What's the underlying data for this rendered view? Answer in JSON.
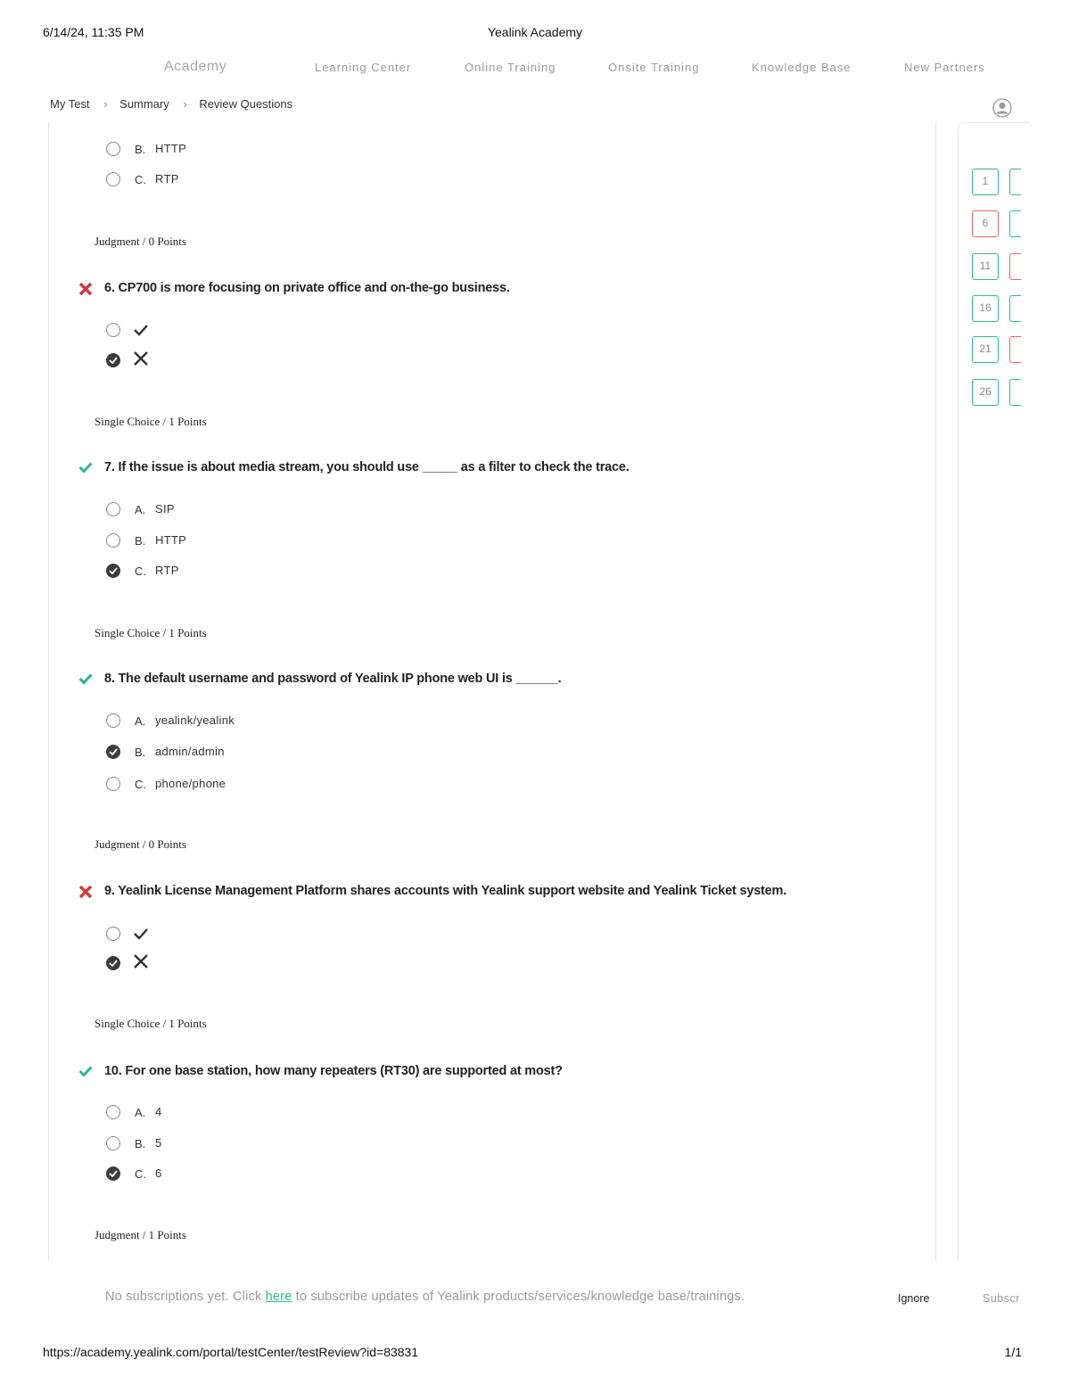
{
  "print_header": {
    "date": "6/14/24, 11:35 PM",
    "title": "Yealink Academy"
  },
  "nav": {
    "logo": "Academy",
    "items": [
      "Learning Center",
      "Online Training",
      "Onsite Training",
      "Knowledge Base",
      "New Partners"
    ]
  },
  "breadcrumb": [
    "My Test",
    "Summary",
    "Review Questions"
  ],
  "questions": [
    {
      "options": [
        {
          "letter": "B.",
          "text": "HTTP",
          "selected": false
        },
        {
          "letter": "C.",
          "text": "RTP",
          "selected": false
        }
      ]
    },
    {
      "type": "Judgment / 0 Points",
      "title": "6. CP700 is more focusing on private office and on-the-go business.",
      "result": "wrong",
      "options": [
        {
          "glyph": "check-icon",
          "selected": false
        },
        {
          "glyph": "cross-icon",
          "selected": true
        }
      ]
    },
    {
      "type": "Single Choice / 1 Points",
      "title": "7. If the issue is about media stream, you should use _____ as a filter to check the trace.",
      "result": "correct",
      "options": [
        {
          "letter": "A.",
          "text": "SIP",
          "selected": false
        },
        {
          "letter": "B.",
          "text": "HTTP",
          "selected": false
        },
        {
          "letter": "C.",
          "text": "RTP",
          "selected": true
        }
      ]
    },
    {
      "type": "Single Choice / 1 Points",
      "title": "8. The default username and password of Yealink IP phone web UI is ______.",
      "result": "correct",
      "options": [
        {
          "letter": "A.",
          "text": "yealink/yealink",
          "selected": false
        },
        {
          "letter": "B.",
          "text": "admin/admin",
          "selected": true
        },
        {
          "letter": "C.",
          "text": "phone/phone",
          "selected": false
        }
      ]
    },
    {
      "type": "Judgment / 0 Points",
      "title": "9. Yealink License Management Platform shares accounts with Yealink support website and Yealink Ticket system.",
      "result": "wrong",
      "options": [
        {
          "glyph": "check-icon",
          "selected": false
        },
        {
          "glyph": "cross-icon",
          "selected": true
        }
      ]
    },
    {
      "type": "Single Choice / 1 Points",
      "title": "10. For one base station, how many repeaters (RT30) are supported at most?",
      "result": "correct",
      "options": [
        {
          "letter": "A.",
          "text": "4",
          "selected": false
        },
        {
          "letter": "B.",
          "text": "5",
          "selected": false
        },
        {
          "letter": "C.",
          "text": "6",
          "selected": true
        }
      ]
    },
    {
      "type": "Judgment / 1 Points"
    }
  ],
  "sidebar": {
    "numbers": [
      {
        "label": "1",
        "status": "correct"
      },
      {
        "label": "6",
        "status": "wrong"
      },
      {
        "label": "11",
        "status": "correct"
      },
      {
        "label": "16",
        "status": "correct"
      },
      {
        "label": "21",
        "status": "correct"
      },
      {
        "label": "26",
        "status": "correct"
      }
    ],
    "second_column": [
      "correct",
      "correct",
      "wrong",
      "correct",
      "wrong",
      "correct"
    ]
  },
  "subscription": {
    "text_before": "No subscriptions yet. Click ",
    "link": "here",
    "text_after": " to subscribe updates of Yealink products/services/knowledge base/trainings.",
    "ignore": "Ignore",
    "subscribe": "Subscr"
  },
  "print_footer": {
    "url": "https://academy.yealink.com/portal/testCenter/testReview?id=83831",
    "page": "1/1"
  },
  "colors": {
    "correct": "#2cb59b",
    "wrong": "#d33a3a",
    "accent": "#2cb59b"
  }
}
